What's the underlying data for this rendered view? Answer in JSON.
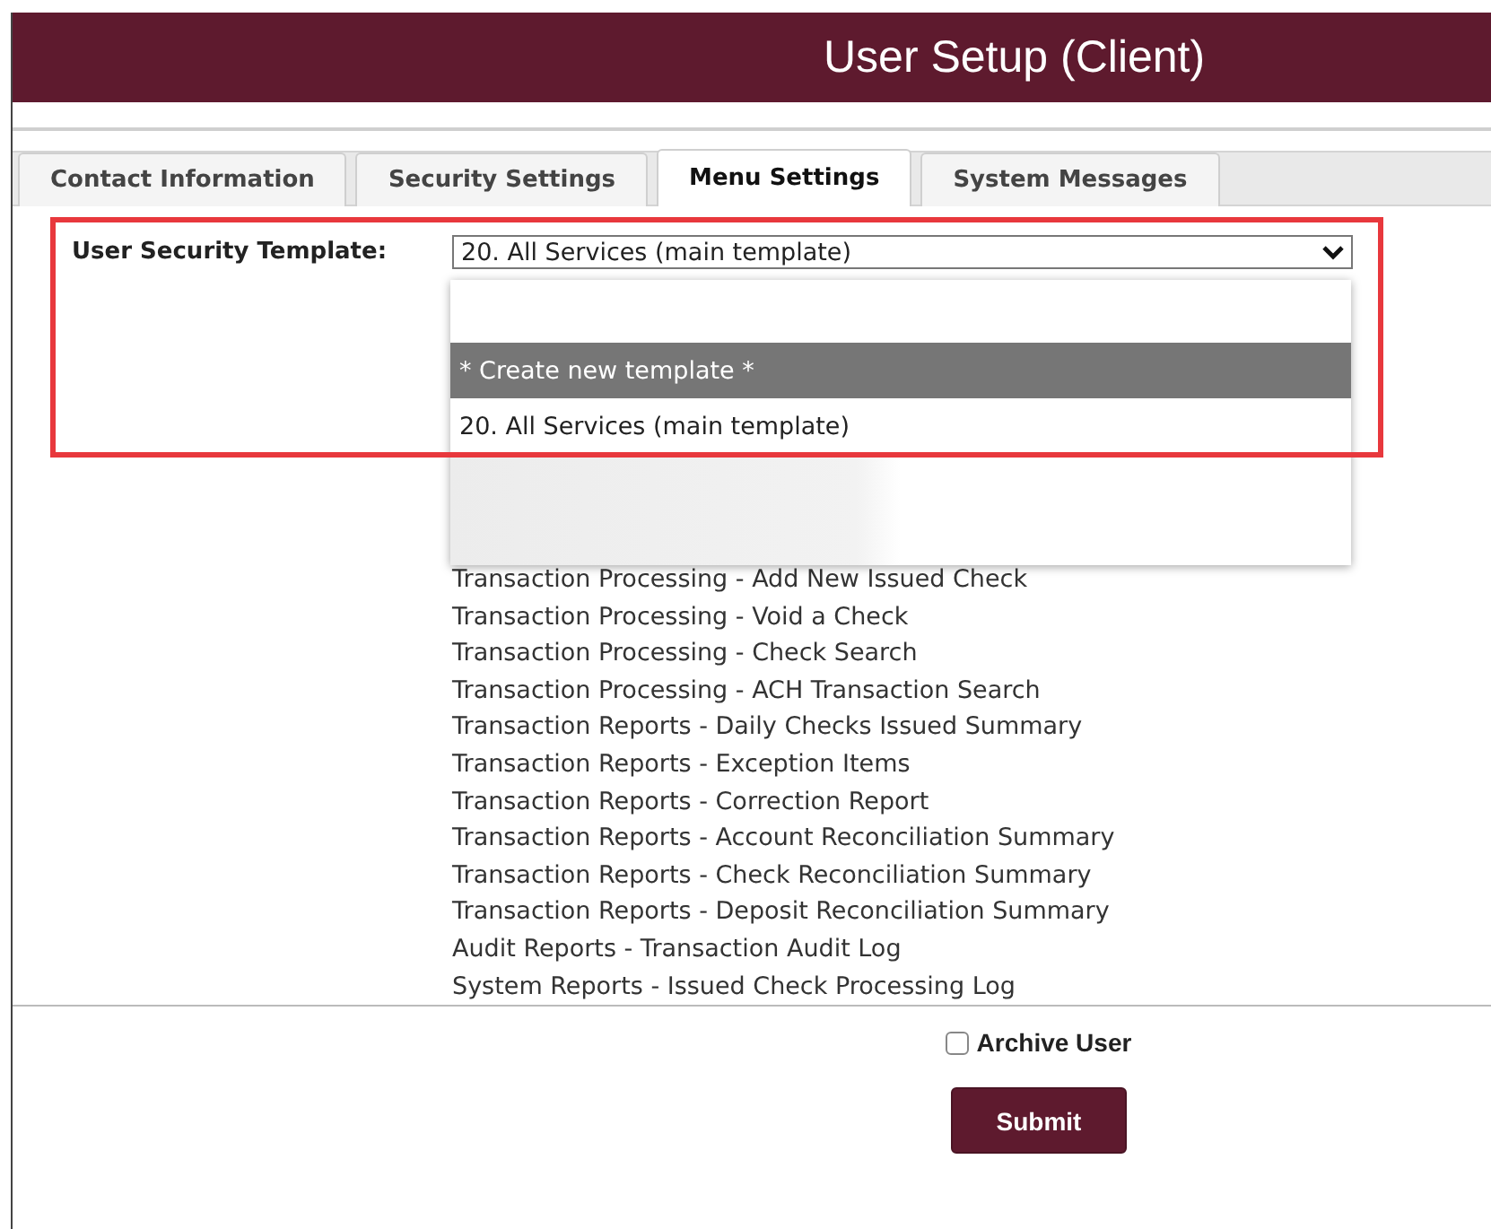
{
  "header": {
    "title": "User Setup (Client)"
  },
  "tabs": [
    {
      "label": "Contact Information",
      "selected": false
    },
    {
      "label": "Security Settings",
      "selected": false
    },
    {
      "label": "Menu Settings",
      "selected": true
    },
    {
      "label": "System Messages",
      "selected": false
    }
  ],
  "template_field": {
    "label": "User Security Template:",
    "value": "20. All Services (main template)"
  },
  "dropdown": {
    "options": [
      {
        "kind": "option",
        "label": "* Create new template *",
        "selected": true
      },
      {
        "kind": "option",
        "label": "20. All Services (main template)",
        "selected": false
      },
      {
        "kind": "blurred",
        "selected": false
      }
    ]
  },
  "menu_items": [
    "Transaction Processing - Add New Issued Check",
    "Transaction Processing - Void a Check",
    "Transaction Processing - Check Search",
    "Transaction Processing - ACH Transaction Search",
    "Transaction Reports - Daily Checks Issued Summary",
    "Transaction Reports - Exception Items",
    "Transaction Reports - Correction Report",
    "Transaction Reports - Account Reconciliation Summary",
    "Transaction Reports - Check Reconciliation Summary",
    "Transaction Reports - Deposit Reconciliation Summary",
    "Audit Reports - Transaction Audit Log",
    "System Reports - Issued Check Processing Log"
  ],
  "archive_user": {
    "label": "Archive User",
    "checked": false
  },
  "submit": {
    "label": "Submit"
  }
}
